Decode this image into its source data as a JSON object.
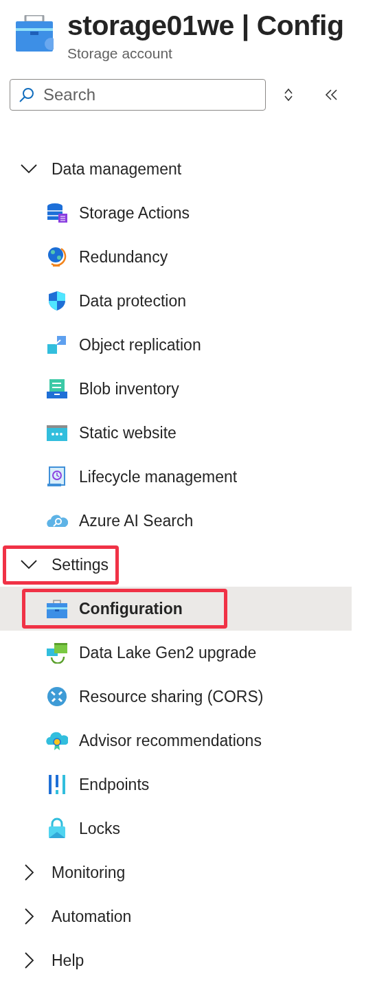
{
  "header": {
    "title": "storage01we | Config",
    "subtitle": "Storage account"
  },
  "search": {
    "placeholder": "Search"
  },
  "nav": [
    {
      "label": "Data management",
      "expanded": true,
      "annotated": false,
      "children": [
        {
          "label": "Storage Actions",
          "selected": false,
          "annotated": false
        },
        {
          "label": "Redundancy",
          "selected": false,
          "annotated": false
        },
        {
          "label": "Data protection",
          "selected": false,
          "annotated": false
        },
        {
          "label": "Object replication",
          "selected": false,
          "annotated": false
        },
        {
          "label": "Blob inventory",
          "selected": false,
          "annotated": false
        },
        {
          "label": "Static website",
          "selected": false,
          "annotated": false
        },
        {
          "label": "Lifecycle management",
          "selected": false,
          "annotated": false
        },
        {
          "label": "Azure AI Search",
          "selected": false,
          "annotated": false
        }
      ]
    },
    {
      "label": "Settings",
      "expanded": true,
      "annotated": true,
      "children": [
        {
          "label": "Configuration",
          "selected": true,
          "annotated": true
        },
        {
          "label": "Data Lake Gen2 upgrade",
          "selected": false,
          "annotated": false
        },
        {
          "label": "Resource sharing (CORS)",
          "selected": false,
          "annotated": false
        },
        {
          "label": "Advisor recommendations",
          "selected": false,
          "annotated": false
        },
        {
          "label": "Endpoints",
          "selected": false,
          "annotated": false
        },
        {
          "label": "Locks",
          "selected": false,
          "annotated": false
        }
      ]
    },
    {
      "label": "Monitoring",
      "expanded": false,
      "annotated": false
    },
    {
      "label": "Automation",
      "expanded": false,
      "annotated": false
    },
    {
      "label": "Help",
      "expanded": false,
      "annotated": false
    }
  ]
}
